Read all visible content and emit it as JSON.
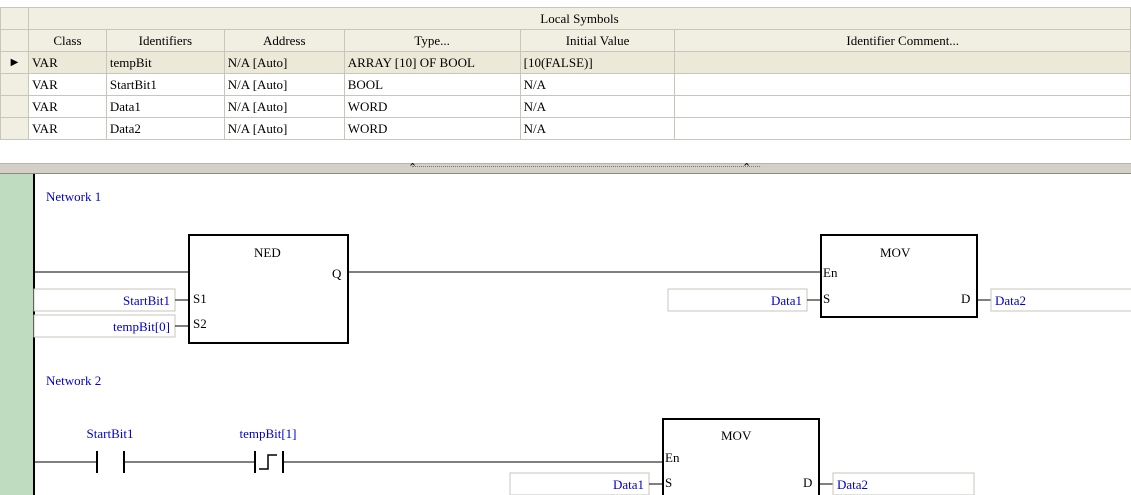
{
  "symbols_table": {
    "section_title": "Local Symbols",
    "columns": [
      "Class",
      "Identifiers",
      "Address",
      "Type...",
      "Initial Value",
      "Identifier Comment..."
    ],
    "rows": [
      {
        "class": "VAR",
        "identifier": "tempBit",
        "address": "N/A [Auto]",
        "type": "ARRAY [10] OF BOOL",
        "initial": "[10(FALSE)]",
        "comment": "",
        "selected": true
      },
      {
        "class": "VAR",
        "identifier": "StartBit1",
        "address": "N/A [Auto]",
        "type": "BOOL",
        "initial": "N/A",
        "comment": ""
      },
      {
        "class": "VAR",
        "identifier": "Data1",
        "address": "N/A [Auto]",
        "type": "WORD",
        "initial": "N/A",
        "comment": ""
      },
      {
        "class": "VAR",
        "identifier": "Data2",
        "address": "N/A [Auto]",
        "type": "WORD",
        "initial": "N/A",
        "comment": ""
      }
    ],
    "current_row_marker": "▶"
  },
  "splitter": {
    "arrow_up": "⌃"
  },
  "ladder": {
    "network1": {
      "title": "Network 1",
      "ned_block": {
        "name": "NED",
        "output": "Q",
        "in1": "S1",
        "in2": "S2",
        "arg1": "StartBit1",
        "arg2": "tempBit[0]"
      },
      "mov_block": {
        "name": "MOV",
        "en": "En",
        "src_pin": "S",
        "dst_pin": "D",
        "src": "Data1",
        "dst": "Data2"
      }
    },
    "network2": {
      "title": "Network 2",
      "contact1": "StartBit1",
      "contact2": "tempBit[1]",
      "mov_block": {
        "name": "MOV",
        "en": "En",
        "src_pin": "S",
        "dst_pin": "D",
        "src": "Data1",
        "dst": "Data2"
      }
    }
  },
  "colors": {
    "variable_text": "#0000c8",
    "power_rail": "#c0dcc0",
    "header_bg": "#f1efe2"
  }
}
